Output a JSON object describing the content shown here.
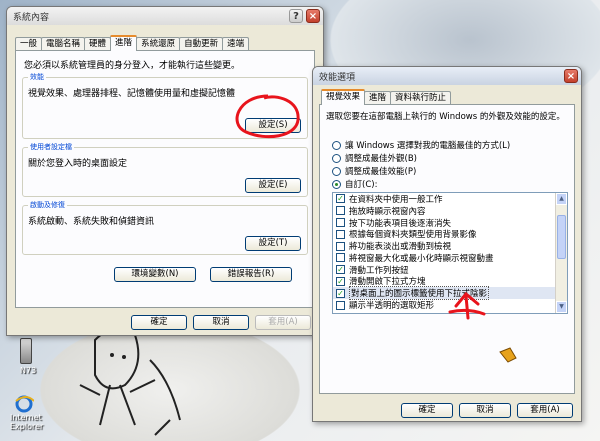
{
  "desktop": {
    "phone_label": "N73",
    "ie_label": "Internet\nExplorer"
  },
  "system_properties": {
    "title": "系統內容",
    "tabs": [
      "一般",
      "電腦名稱",
      "硬體",
      "進階",
      "系統還原",
      "自動更新",
      "遠端"
    ],
    "active_tab": 3,
    "admin_note": "您必須以系統管理員的身分登入，才能執行這些變更。",
    "performance": {
      "title": "效能",
      "text": "視覺效果、處理器排程、記憶體使用量和虛擬記憶體",
      "button": "設定(S)"
    },
    "user_profiles": {
      "title": "使用者設定檔",
      "text": "關於您登入時的桌面設定",
      "button": "設定(E)"
    },
    "startup_recovery": {
      "title": "啟動及修復",
      "text": "系統啟動、系統失敗和偵錯資訊",
      "button": "設定(T)"
    },
    "env_button": "環境變數(N)",
    "error_report_button": "錯誤報告(R)",
    "ok": "確定",
    "cancel": "取消",
    "apply": "套用(A)"
  },
  "performance_options": {
    "title": "效能選項",
    "tabs": [
      "視覺效果",
      "進階",
      "資料執行防止"
    ],
    "active_tab": 0,
    "description": "選取您要在這部電腦上執行的 Windows 的外觀及效能的設定。",
    "radios": [
      {
        "label": "讓 Windows 選擇對我的電腦最佳的方式(L)",
        "checked": false
      },
      {
        "label": "調整成最佳外觀(B)",
        "checked": false
      },
      {
        "label": "調整成最佳效能(P)",
        "checked": false
      },
      {
        "label": "自訂(C):",
        "checked": true
      }
    ],
    "effects": [
      {
        "label": "在資料夾中使用一般工作",
        "checked": true
      },
      {
        "label": "拖放時顯示視窗內容",
        "checked": false
      },
      {
        "label": "按下功能表項目後逐漸消失",
        "checked": false
      },
      {
        "label": "根據每個資料夾類型使用背景影像",
        "checked": false
      },
      {
        "label": "將功能表淡出或滑動到檢視",
        "checked": false
      },
      {
        "label": "將視窗最大化或最小化時顯示視窗動畫",
        "checked": false
      },
      {
        "label": "滑動工作列按鈕",
        "checked": true
      },
      {
        "label": "滑動開啟下拉式方塊",
        "checked": true
      },
      {
        "label": "對桌面上的圖示標籤使用下拉式陰影",
        "checked": true,
        "highlighted": true
      },
      {
        "label": "顯示半透明的選取矩形",
        "checked": false
      }
    ],
    "ok": "確定",
    "cancel": "取消",
    "apply": "套用(A)"
  },
  "colors": {
    "annotation_red": "#e8141c",
    "accent_orange": "#e68b2c",
    "cursor_yellow": "#e7a21c"
  }
}
